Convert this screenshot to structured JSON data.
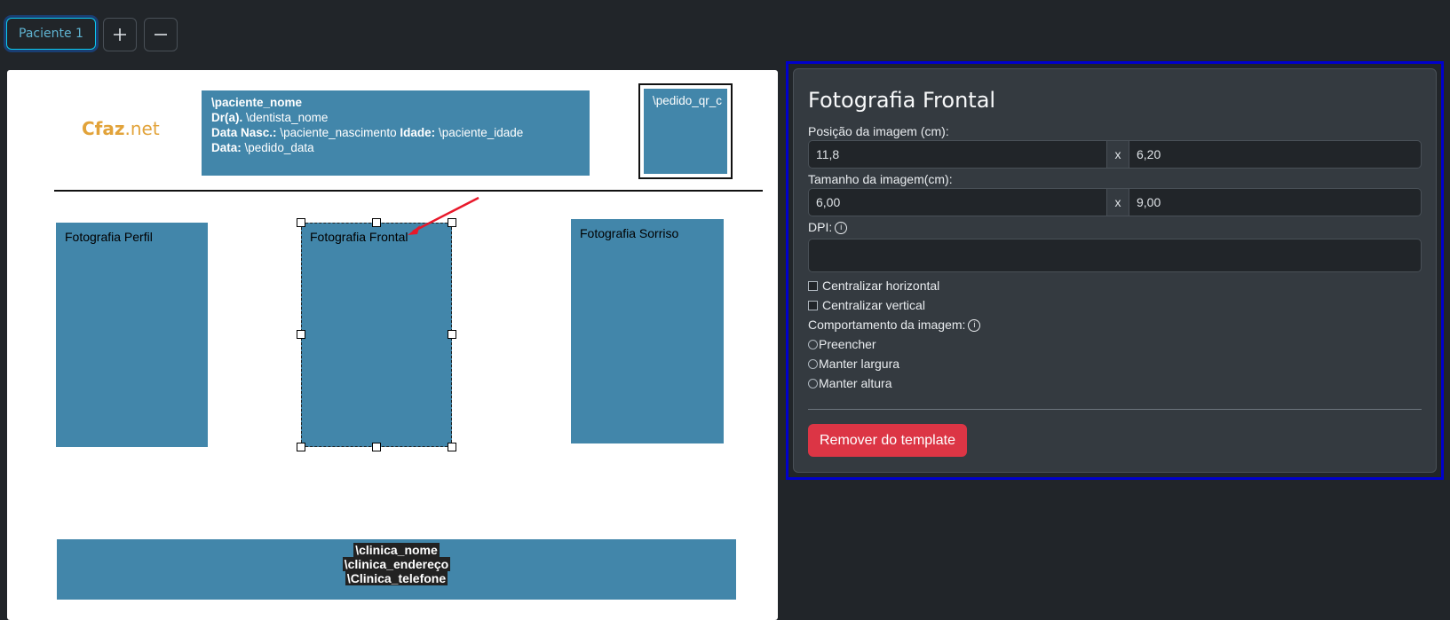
{
  "toolbar": {
    "tab_label": "Paciente 1",
    "add_icon": "plus-icon",
    "remove_icon": "minus-icon"
  },
  "template": {
    "logo": {
      "part1": "Cfaz",
      "part2": ".net"
    },
    "patient_info": {
      "name_var": "\\paciente_nome",
      "dentist_label": "Dr(a).",
      "dentist_var": "\\dentista_nome",
      "birth_label": "Data Nasc.:",
      "birth_var": "\\paciente_nascimento",
      "age_label": "Idade:",
      "age_var": "\\paciente_idade",
      "date_label": "Data:",
      "date_var": "\\pedido_data"
    },
    "qr_label": "\\pedido_qr_c",
    "photos": {
      "profile": "Fotografia Perfil",
      "frontal": "Fotografia Frontal",
      "smile": "Fotografia Sorriso"
    },
    "footer": {
      "clinic_name": "\\clinica_nome",
      "clinic_address": "\\clinica_endereço",
      "clinic_phone": "\\Clinica_telefone"
    }
  },
  "properties": {
    "title": "Fotografia Frontal",
    "position_label": "Posição da imagem (cm):",
    "position_x": "11,8",
    "position_y": "6,20",
    "size_label": "Tamanho da imagem(cm):",
    "size_w": "6,00",
    "size_h": "9,00",
    "separator": "x",
    "dpi_label": "DPI:",
    "dpi_value": "",
    "center_h": "Centralizar horizontal",
    "center_v": "Centralizar vertical",
    "behavior_label": "Comportamento da imagem:",
    "behavior_options": [
      "Preencher",
      "Manter largura",
      "Manter altura"
    ],
    "remove_button": "Remover do template"
  },
  "colors": {
    "accent_block": "#4286aa",
    "danger": "#dc3545",
    "selection_outline": "#0000cc"
  }
}
